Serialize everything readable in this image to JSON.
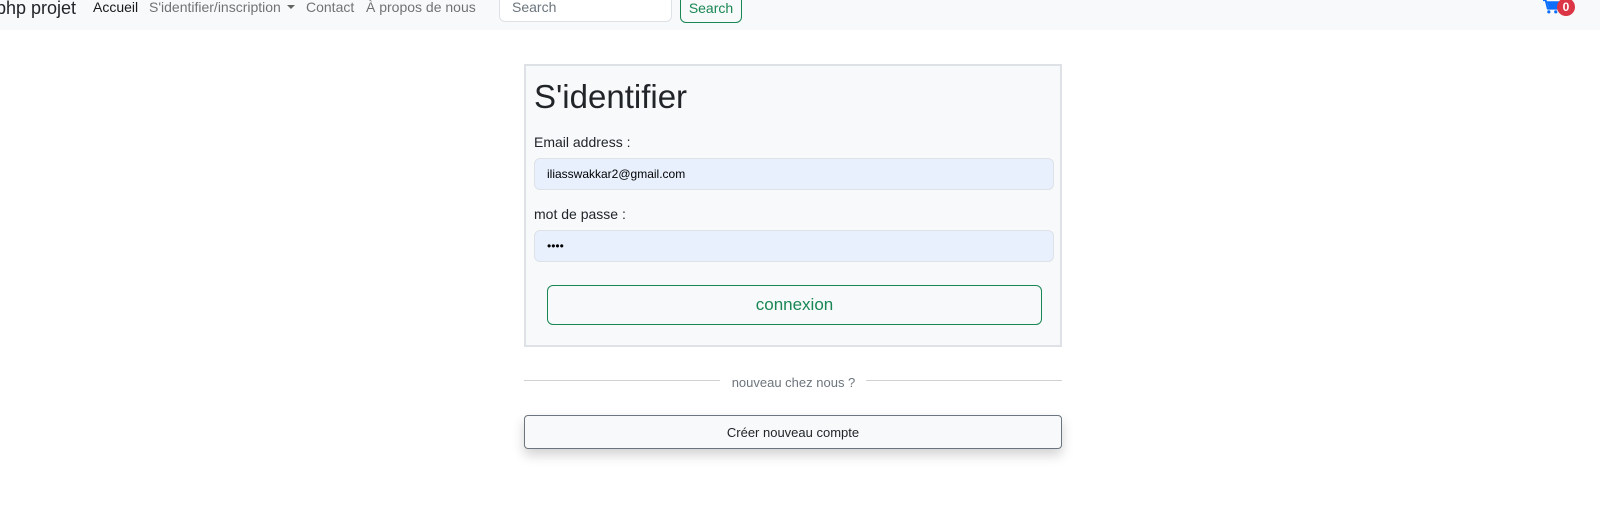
{
  "navbar": {
    "brand": "php projet",
    "links": {
      "home": "Accueil",
      "account": "S'identifier/inscription",
      "contact": "Contact",
      "about": "À propos de nous"
    },
    "search": {
      "placeholder": "Search",
      "value": "",
      "button_label": "Search"
    },
    "cart": {
      "icon": "shopping-cart-icon",
      "count": "0",
      "badge_color": "#dc3545",
      "icon_color": "#0d6efd"
    }
  },
  "login": {
    "title": "S'identifier",
    "email_label": "Email address :",
    "email_value": "iliasswakkar2@gmail.com",
    "password_label": "mot de passe :",
    "password_value": "••••",
    "submit_label": "connexion"
  },
  "divider": {
    "text": "nouveau chez nous ?"
  },
  "create_account": {
    "label": "Créer nouveau compte"
  },
  "colors": {
    "accent": "#198754",
    "navbar_bg": "#f8f9fa",
    "autofill_bg": "#e8f0fe"
  }
}
